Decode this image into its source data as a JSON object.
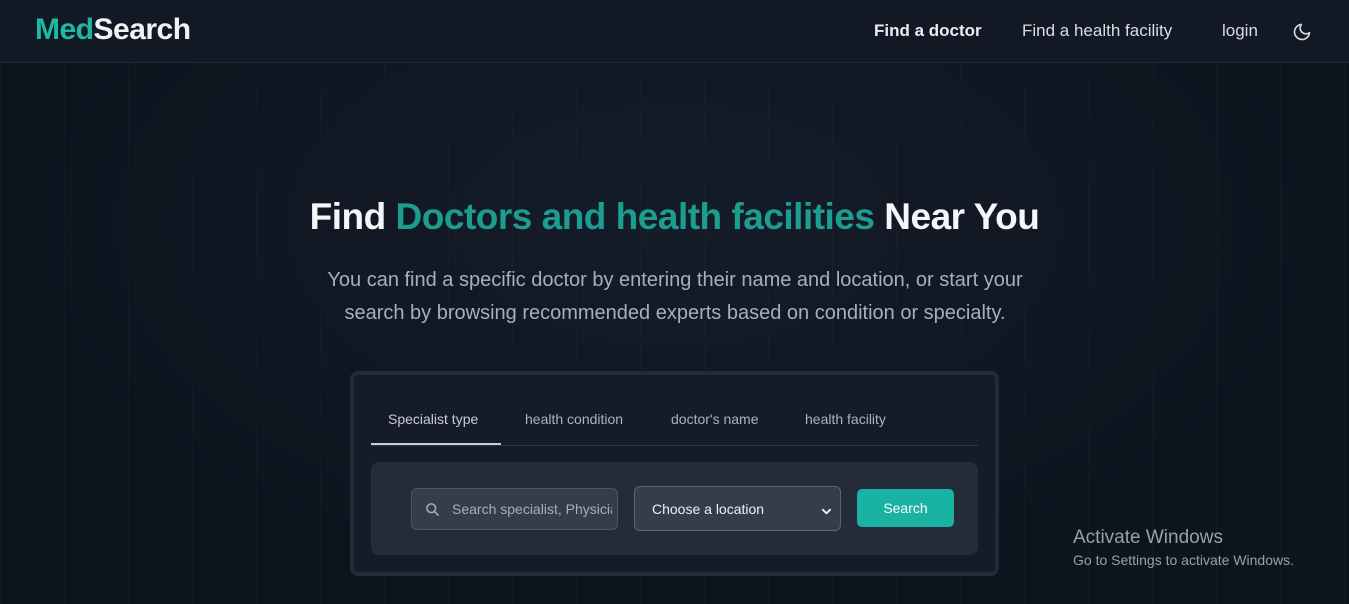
{
  "header": {
    "logo_part1": "Med",
    "logo_part2": "Search",
    "nav": {
      "find_doctor": "Find a doctor",
      "find_facility": "Find a health facility",
      "login": "login"
    },
    "theme_toggle_icon": "moon-icon"
  },
  "hero": {
    "title_part1": "Find ",
    "title_accent": "Doctors and health facilities",
    "title_part2": " Near You",
    "subtitle": "You can find a specific doctor by entering their name and location, or start your search by browsing recommended experts based on condition or specialty."
  },
  "search_card": {
    "tabs": [
      {
        "label": "Specialist type",
        "active": true
      },
      {
        "label": "health condition",
        "active": false
      },
      {
        "label": "doctor's name",
        "active": false
      },
      {
        "label": "health facility",
        "active": false
      }
    ],
    "search_placeholder": "Search specialist, Physician",
    "location_value": "Choose a location",
    "search_button": "Search"
  },
  "watermark": {
    "line1": "Activate Windows",
    "line2": "Go to Settings to activate Windows."
  },
  "colors": {
    "accent": "#1fb8a4",
    "background": "#0f1520",
    "button": "#1ab2a3"
  }
}
